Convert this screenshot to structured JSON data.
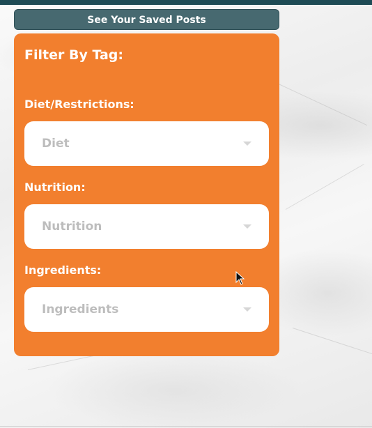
{
  "saved_posts_button": {
    "label": "See Your Saved Posts"
  },
  "filter_panel": {
    "title": "Filter By Tag:",
    "groups": [
      {
        "label": "Diet/Restrictions:",
        "placeholder": "Diet"
      },
      {
        "label": "Nutrition:",
        "placeholder": "Nutrition"
      },
      {
        "label": "Ingredients:",
        "placeholder": "Ingredients"
      }
    ]
  },
  "colors": {
    "header_strip": "#1e4b55",
    "saved_button_bg": "#476970",
    "panel_bg": "#f27f2e",
    "select_bg": "#ffffff",
    "select_text": "#bdbdbd",
    "label_text": "#ffffff"
  },
  "icons": {
    "select_caret": "chevron-down-icon",
    "pointer": "mouse-cursor-icon"
  }
}
